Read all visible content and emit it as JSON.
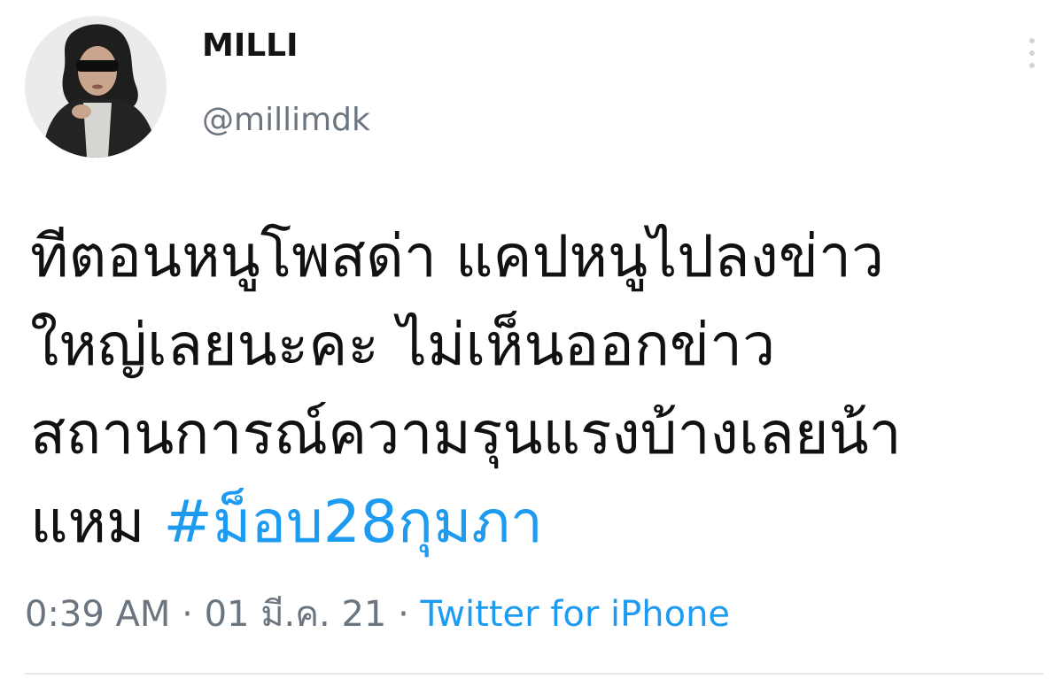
{
  "user": {
    "display_name": "MILLI",
    "handle": "@millimdk"
  },
  "tweet": {
    "lines": [
      "ทีตอนหนูโพสด่า แคปหนูไปลงข่าว",
      "ใหญ่เลยนะคะ ไม่เห็นออกข่าว",
      "สถานการณ์ความรุนแรงบ้างเลยน้า"
    ],
    "last_line_text": "แหม ",
    "hashtag": "#ม็อบ28กุมภา"
  },
  "meta": {
    "time": "0:39 AM",
    "separator": "·",
    "date": "01 มี.ค. 21",
    "source": "Twitter for iPhone"
  },
  "icons": {
    "more": "more-vertical-icon",
    "avatar": "avatar"
  },
  "colors": {
    "link": "#1d9bf0",
    "secondary_text": "#6b7580",
    "primary_text": "#111111"
  }
}
